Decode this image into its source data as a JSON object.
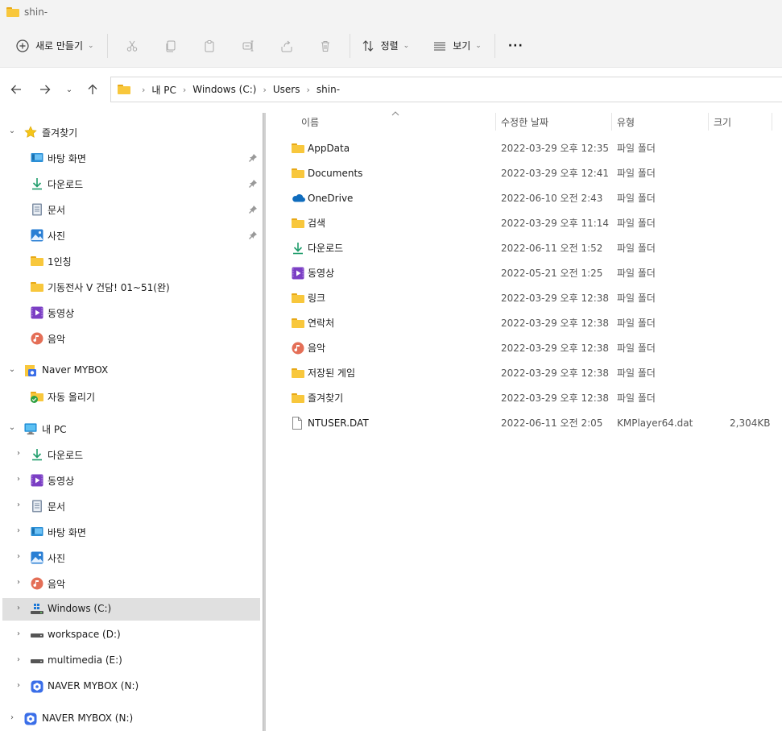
{
  "window": {
    "title": "shin-"
  },
  "toolbar": {
    "new_label": "새로 만들기",
    "sort_label": "정렬",
    "view_label": "보기",
    "more_label": "···"
  },
  "address": {
    "crumbs": [
      "내 PC",
      "Windows (C:)",
      "Users",
      "shin-"
    ]
  },
  "sidebar": {
    "quick_access": "즐겨찾기",
    "quick_items": [
      {
        "label": "바탕 화면",
        "icon": "desktop-icon",
        "pinned": true
      },
      {
        "label": "다운로드",
        "icon": "download-icon",
        "pinned": true
      },
      {
        "label": "문서",
        "icon": "document-icon",
        "pinned": true
      },
      {
        "label": "사진",
        "icon": "pictures-icon",
        "pinned": true
      },
      {
        "label": "1인칭",
        "icon": "folder-icon",
        "pinned": false
      },
      {
        "label": "기동전사 V 건담! 01~51(완)",
        "icon": "folder-icon",
        "pinned": false
      },
      {
        "label": "동영상",
        "icon": "video-icon",
        "pinned": false
      },
      {
        "label": "음악",
        "icon": "music-icon",
        "pinned": false
      }
    ],
    "mybox": "Naver MYBOX",
    "mybox_items": [
      {
        "label": "자동 올리기",
        "icon": "folder-sync-icon"
      }
    ],
    "this_pc": "내 PC",
    "pc_items": [
      {
        "label": "다운로드",
        "icon": "download-icon"
      },
      {
        "label": "동영상",
        "icon": "video-icon"
      },
      {
        "label": "문서",
        "icon": "document-icon"
      },
      {
        "label": "바탕 화면",
        "icon": "desktop-icon"
      },
      {
        "label": "사진",
        "icon": "pictures-icon"
      },
      {
        "label": "음악",
        "icon": "music-icon"
      },
      {
        "label": "Windows (C:)",
        "icon": "windows-drive-icon",
        "selected": true
      },
      {
        "label": "workspace (D:)",
        "icon": "drive-icon"
      },
      {
        "label": "multimedia (E:)",
        "icon": "drive-icon"
      },
      {
        "label": "NAVER MYBOX (N:)",
        "icon": "mybox-drive-icon"
      }
    ],
    "bottom_item": "NAVER MYBOX (N:)"
  },
  "columns": {
    "name": "이름",
    "date": "수정한 날짜",
    "type": "유형",
    "size": "크기"
  },
  "files": [
    {
      "name": "AppData",
      "date": "2022-03-29 오후 12:35",
      "type": "파일 폴더",
      "size": "",
      "icon": "folder-icon"
    },
    {
      "name": "Documents",
      "date": "2022-03-29 오후 12:41",
      "type": "파일 폴더",
      "size": "",
      "icon": "folder-icon"
    },
    {
      "name": "OneDrive",
      "date": "2022-06-10 오전 2:43",
      "type": "파일 폴더",
      "size": "",
      "icon": "cloud-icon"
    },
    {
      "name": "검색",
      "date": "2022-03-29 오후 11:14",
      "type": "파일 폴더",
      "size": "",
      "icon": "folder-icon"
    },
    {
      "name": "다운로드",
      "date": "2022-06-11 오전 1:52",
      "type": "파일 폴더",
      "size": "",
      "icon": "download-icon"
    },
    {
      "name": "동영상",
      "date": "2022-05-21 오전 1:25",
      "type": "파일 폴더",
      "size": "",
      "icon": "video-icon"
    },
    {
      "name": "링크",
      "date": "2022-03-29 오후 12:38",
      "type": "파일 폴더",
      "size": "",
      "icon": "folder-icon"
    },
    {
      "name": "연락처",
      "date": "2022-03-29 오후 12:38",
      "type": "파일 폴더",
      "size": "",
      "icon": "folder-icon"
    },
    {
      "name": "음악",
      "date": "2022-03-29 오후 12:38",
      "type": "파일 폴더",
      "size": "",
      "icon": "music-icon"
    },
    {
      "name": "저장된 게임",
      "date": "2022-03-29 오후 12:38",
      "type": "파일 폴더",
      "size": "",
      "icon": "folder-icon"
    },
    {
      "name": "즐겨찾기",
      "date": "2022-03-29 오후 12:38",
      "type": "파일 폴더",
      "size": "",
      "icon": "folder-icon"
    },
    {
      "name": "NTUSER.DAT",
      "date": "2022-06-11 오전 2:05",
      "type": "KMPlayer64.dat",
      "size": "2,304KB",
      "icon": "file-icon"
    }
  ]
}
